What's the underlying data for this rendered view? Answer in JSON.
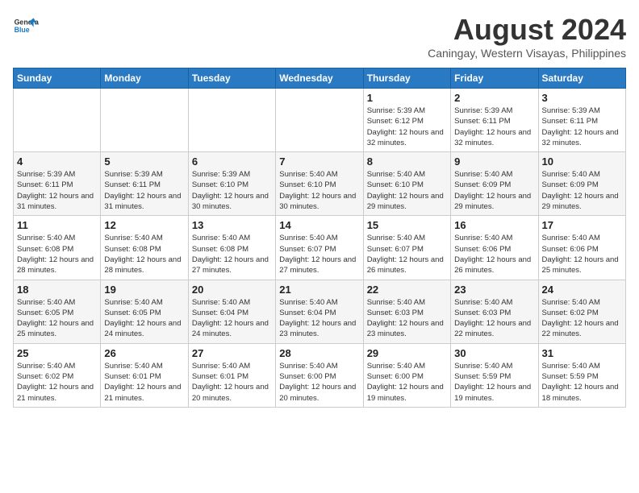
{
  "logo": {
    "general": "General",
    "blue": "Blue"
  },
  "title": {
    "month_year": "August 2024",
    "location": "Caningay, Western Visayas, Philippines"
  },
  "days_of_week": [
    "Sunday",
    "Monday",
    "Tuesday",
    "Wednesday",
    "Thursday",
    "Friday",
    "Saturday"
  ],
  "weeks": [
    {
      "days": [
        {
          "date": "",
          "content": ""
        },
        {
          "date": "",
          "content": ""
        },
        {
          "date": "",
          "content": ""
        },
        {
          "date": "",
          "content": ""
        },
        {
          "date": "1",
          "content": "Sunrise: 5:39 AM\nSunset: 6:12 PM\nDaylight: 12 hours\nand 32 minutes."
        },
        {
          "date": "2",
          "content": "Sunrise: 5:39 AM\nSunset: 6:11 PM\nDaylight: 12 hours\nand 32 minutes."
        },
        {
          "date": "3",
          "content": "Sunrise: 5:39 AM\nSunset: 6:11 PM\nDaylight: 12 hours\nand 32 minutes."
        }
      ]
    },
    {
      "days": [
        {
          "date": "4",
          "content": "Sunrise: 5:39 AM\nSunset: 6:11 PM\nDaylight: 12 hours\nand 31 minutes."
        },
        {
          "date": "5",
          "content": "Sunrise: 5:39 AM\nSunset: 6:11 PM\nDaylight: 12 hours\nand 31 minutes."
        },
        {
          "date": "6",
          "content": "Sunrise: 5:39 AM\nSunset: 6:10 PM\nDaylight: 12 hours\nand 30 minutes."
        },
        {
          "date": "7",
          "content": "Sunrise: 5:40 AM\nSunset: 6:10 PM\nDaylight: 12 hours\nand 30 minutes."
        },
        {
          "date": "8",
          "content": "Sunrise: 5:40 AM\nSunset: 6:10 PM\nDaylight: 12 hours\nand 29 minutes."
        },
        {
          "date": "9",
          "content": "Sunrise: 5:40 AM\nSunset: 6:09 PM\nDaylight: 12 hours\nand 29 minutes."
        },
        {
          "date": "10",
          "content": "Sunrise: 5:40 AM\nSunset: 6:09 PM\nDaylight: 12 hours\nand 29 minutes."
        }
      ]
    },
    {
      "days": [
        {
          "date": "11",
          "content": "Sunrise: 5:40 AM\nSunset: 6:08 PM\nDaylight: 12 hours\nand 28 minutes."
        },
        {
          "date": "12",
          "content": "Sunrise: 5:40 AM\nSunset: 6:08 PM\nDaylight: 12 hours\nand 28 minutes."
        },
        {
          "date": "13",
          "content": "Sunrise: 5:40 AM\nSunset: 6:08 PM\nDaylight: 12 hours\nand 27 minutes."
        },
        {
          "date": "14",
          "content": "Sunrise: 5:40 AM\nSunset: 6:07 PM\nDaylight: 12 hours\nand 27 minutes."
        },
        {
          "date": "15",
          "content": "Sunrise: 5:40 AM\nSunset: 6:07 PM\nDaylight: 12 hours\nand 26 minutes."
        },
        {
          "date": "16",
          "content": "Sunrise: 5:40 AM\nSunset: 6:06 PM\nDaylight: 12 hours\nand 26 minutes."
        },
        {
          "date": "17",
          "content": "Sunrise: 5:40 AM\nSunset: 6:06 PM\nDaylight: 12 hours\nand 25 minutes."
        }
      ]
    },
    {
      "days": [
        {
          "date": "18",
          "content": "Sunrise: 5:40 AM\nSunset: 6:05 PM\nDaylight: 12 hours\nand 25 minutes."
        },
        {
          "date": "19",
          "content": "Sunrise: 5:40 AM\nSunset: 6:05 PM\nDaylight: 12 hours\nand 24 minutes."
        },
        {
          "date": "20",
          "content": "Sunrise: 5:40 AM\nSunset: 6:04 PM\nDaylight: 12 hours\nand 24 minutes."
        },
        {
          "date": "21",
          "content": "Sunrise: 5:40 AM\nSunset: 6:04 PM\nDaylight: 12 hours\nand 23 minutes."
        },
        {
          "date": "22",
          "content": "Sunrise: 5:40 AM\nSunset: 6:03 PM\nDaylight: 12 hours\nand 23 minutes."
        },
        {
          "date": "23",
          "content": "Sunrise: 5:40 AM\nSunset: 6:03 PM\nDaylight: 12 hours\nand 22 minutes."
        },
        {
          "date": "24",
          "content": "Sunrise: 5:40 AM\nSunset: 6:02 PM\nDaylight: 12 hours\nand 22 minutes."
        }
      ]
    },
    {
      "days": [
        {
          "date": "25",
          "content": "Sunrise: 5:40 AM\nSunset: 6:02 PM\nDaylight: 12 hours\nand 21 minutes."
        },
        {
          "date": "26",
          "content": "Sunrise: 5:40 AM\nSunset: 6:01 PM\nDaylight: 12 hours\nand 21 minutes."
        },
        {
          "date": "27",
          "content": "Sunrise: 5:40 AM\nSunset: 6:01 PM\nDaylight: 12 hours\nand 20 minutes."
        },
        {
          "date": "28",
          "content": "Sunrise: 5:40 AM\nSunset: 6:00 PM\nDaylight: 12 hours\nand 20 minutes."
        },
        {
          "date": "29",
          "content": "Sunrise: 5:40 AM\nSunset: 6:00 PM\nDaylight: 12 hours\nand 19 minutes."
        },
        {
          "date": "30",
          "content": "Sunrise: 5:40 AM\nSunset: 5:59 PM\nDaylight: 12 hours\nand 19 minutes."
        },
        {
          "date": "31",
          "content": "Sunrise: 5:40 AM\nSunset: 5:59 PM\nDaylight: 12 hours\nand 18 minutes."
        }
      ]
    }
  ]
}
